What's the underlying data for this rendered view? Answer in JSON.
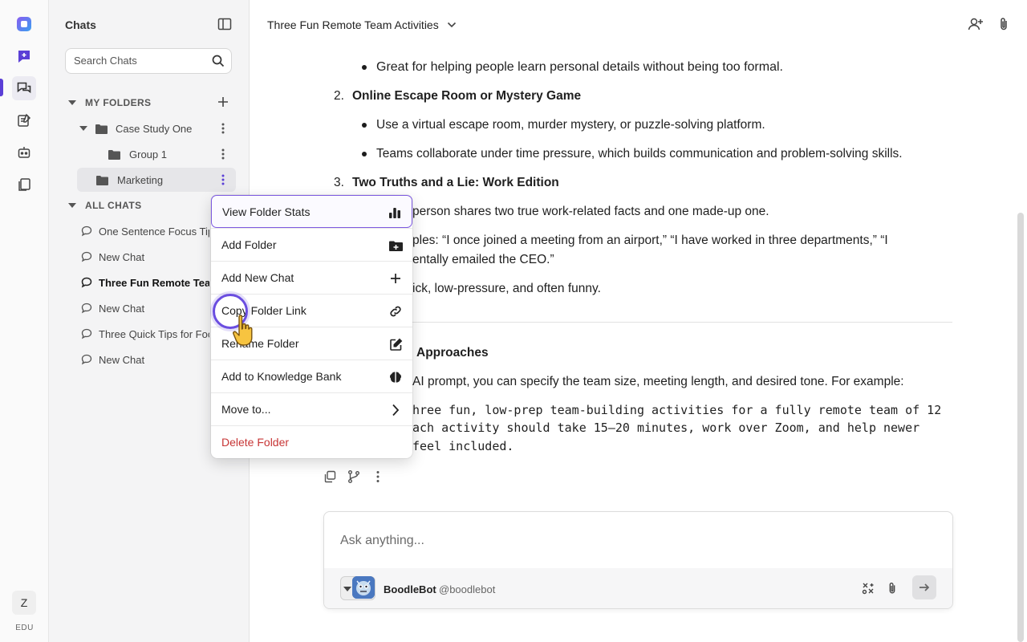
{
  "rail": {
    "user_initial": "Z",
    "edu_label": "EDU"
  },
  "sidebar": {
    "title": "Chats",
    "search_placeholder": "Search Chats",
    "my_folders_label": "MY FOLDERS",
    "folders": [
      {
        "name": "Case Study One"
      },
      {
        "name": "Group 1"
      },
      {
        "name": "Marketing"
      }
    ],
    "all_chats_label": "ALL CHATS",
    "chats": [
      {
        "title": "One Sentence Focus Tip"
      },
      {
        "title": "New Chat"
      },
      {
        "title": "Three Fun Remote Team Activities"
      },
      {
        "title": "New Chat"
      },
      {
        "title": "Three Quick Tips for Focus"
      },
      {
        "title": "New Chat"
      }
    ]
  },
  "header": {
    "chat_title": "Three Fun Remote Team Activities"
  },
  "message": {
    "line_1": "Great for helping people learn personal details without being too formal.",
    "item_2_num": "2.",
    "item_2_title": "Online Escape Room or Mystery Game",
    "item_2_b1": "Use a virtual escape room, murder mystery, or puzzle-solving platform.",
    "item_2_b2": "Teams collaborate under time pressure, which builds communication and problem-solving skills.",
    "item_3_num": "3.",
    "item_3_title": "Two Truths and a Lie: Work Edition",
    "item_3_b1_visible": "person shares two true work-related facts and one made-up one.",
    "item_3_b2_visible_a": "ples: “I once joined a meeting from an airport,” “I have worked in three departments,” “I",
    "item_3_b2_visible_b": "entally emailed the CEO.”",
    "item_3_b3_visible": "ick, low-pressure, and often funny.",
    "section_heading_visible": "Approaches",
    "section_para_visible": "AI prompt, you can specify the team size, meeting length, and desired tone. For example:",
    "code_1": "hree fun, low-prep team-building activities for a fully remote team of 12",
    "code_2": "ach activity should take 15–20 minutes, work over Zoom, and help newer",
    "code_3": "feel included."
  },
  "composer": {
    "placeholder": "Ask anything...",
    "bot_name": "BoodleBot",
    "bot_handle": "@boodlebot"
  },
  "context_menu": {
    "items": [
      {
        "label": "View Folder Stats",
        "icon": "bar-chart-icon"
      },
      {
        "label": "Add Folder",
        "icon": "folder-plus-icon"
      },
      {
        "label": "Add New Chat",
        "icon": "plus-icon"
      },
      {
        "label": "Copy Folder Link",
        "icon": "link-icon"
      },
      {
        "label": "Rename Folder",
        "icon": "edit-icon"
      },
      {
        "label": "Add to Knowledge Bank",
        "icon": "brain-icon"
      },
      {
        "label": "Move to...",
        "icon": "chevron-right-icon"
      },
      {
        "label": "Delete Folder",
        "icon": ""
      }
    ]
  },
  "colors": {
    "accent": "#5b3fd6",
    "danger": "#c73535",
    "selected_border": "#7d5ae0"
  }
}
